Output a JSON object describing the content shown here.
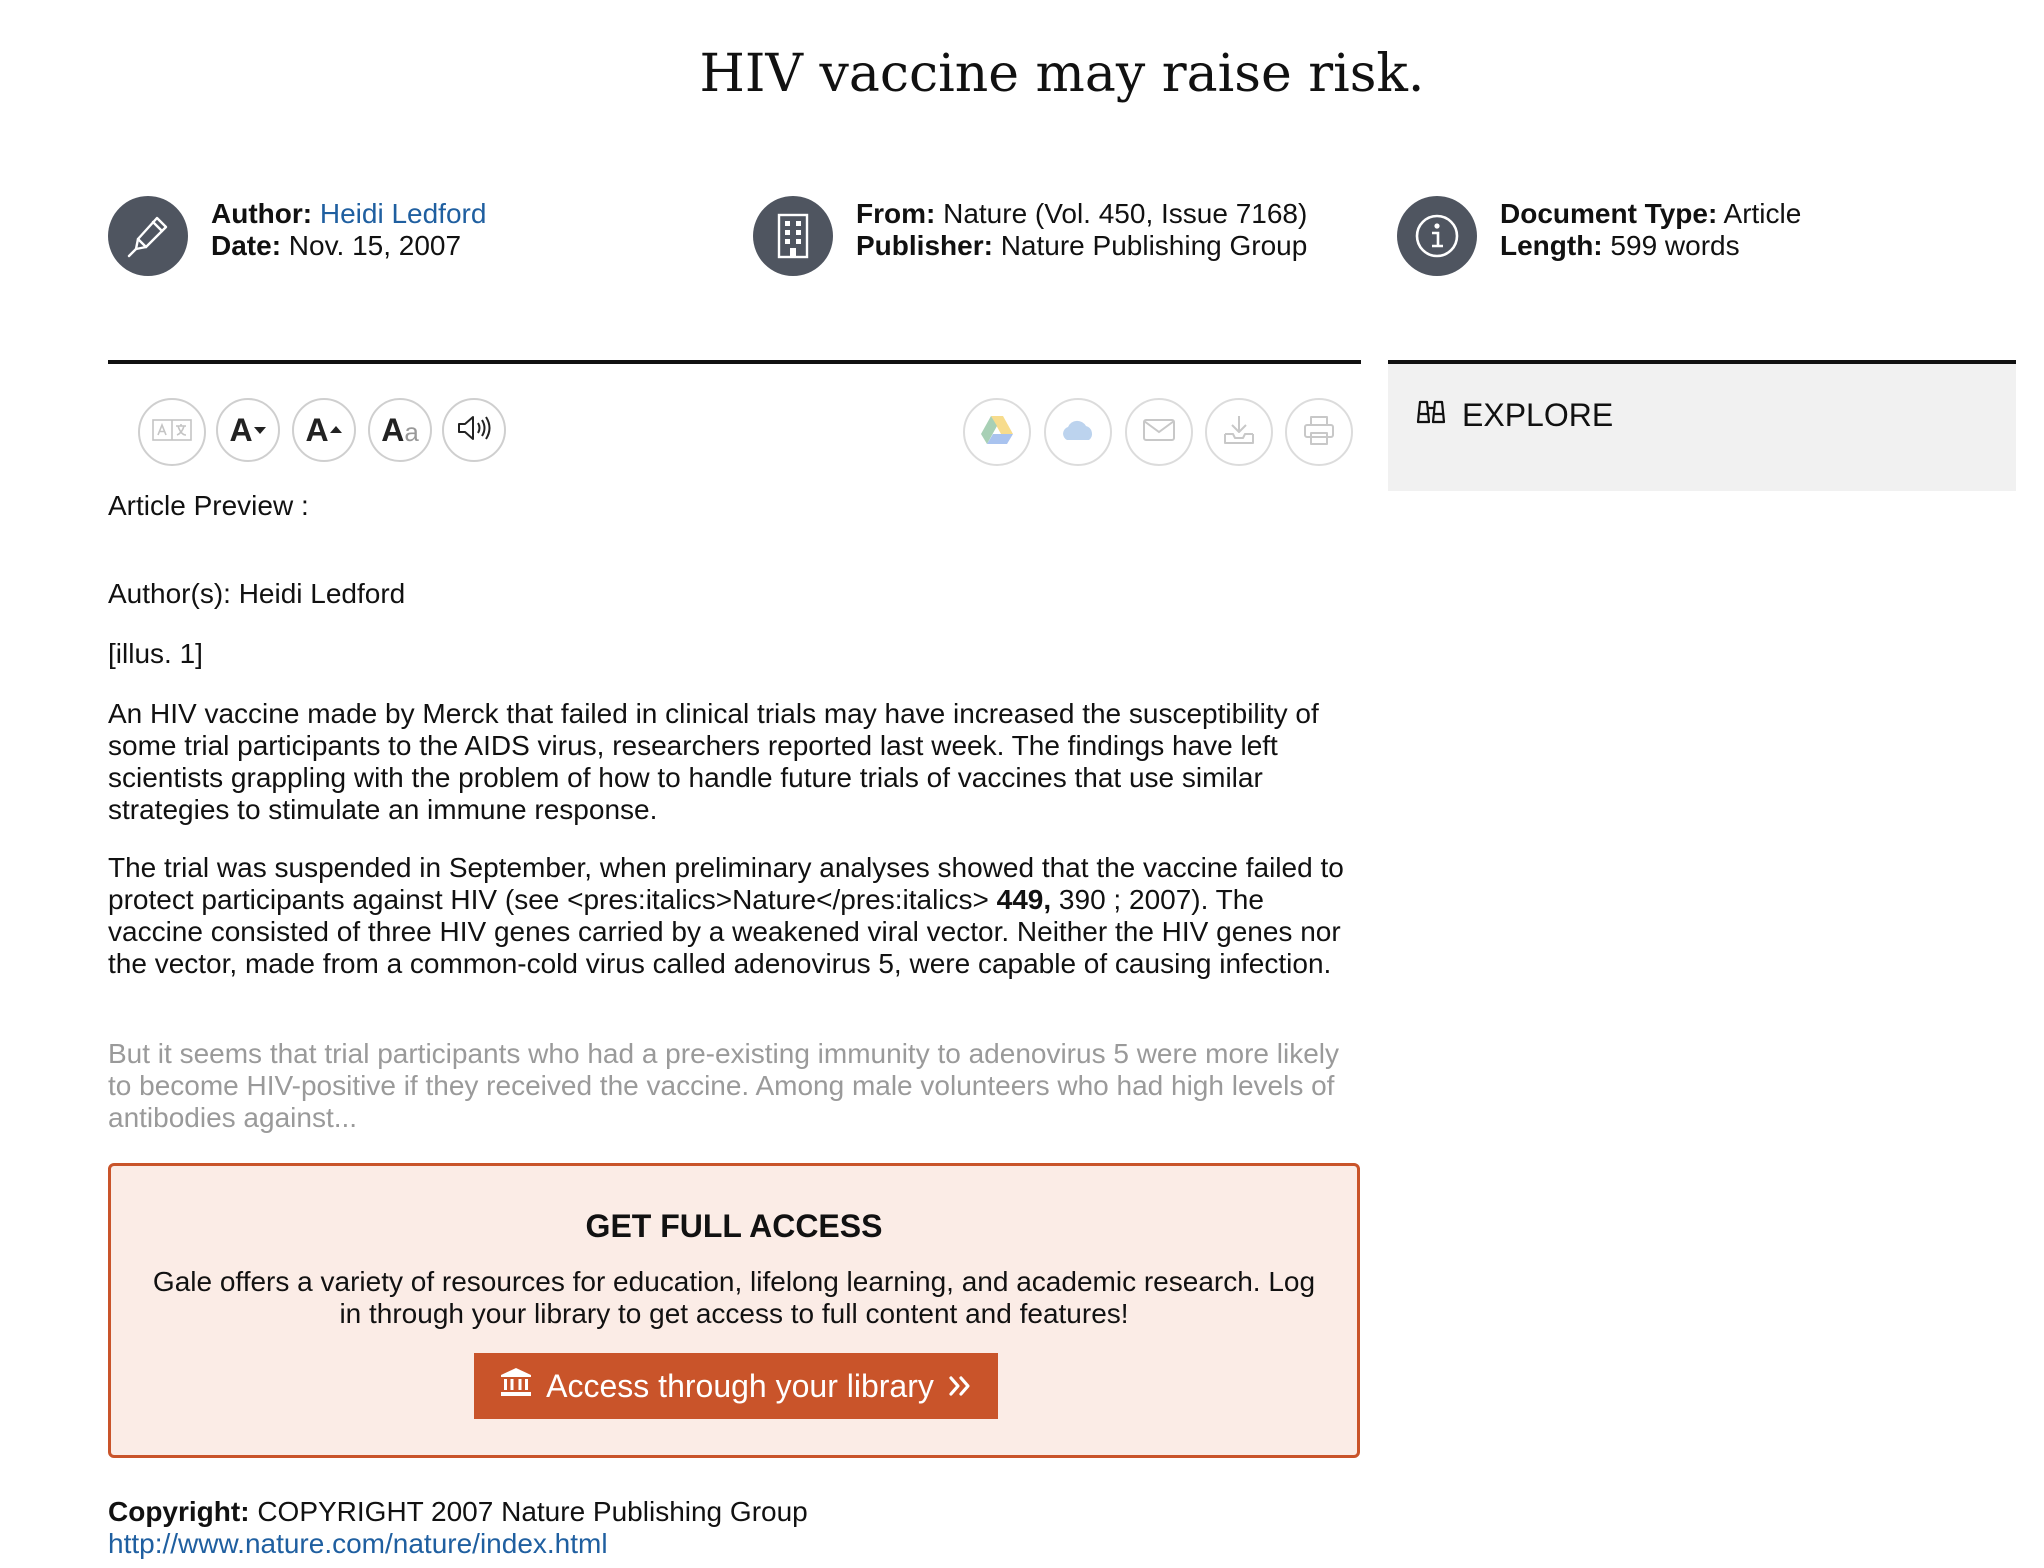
{
  "article": {
    "title": "HIV vaccine may raise risk.",
    "author_label": "Author:",
    "author": "Heidi Ledford",
    "date_label": "Date:",
    "date": "Nov. 15, 2007",
    "from_label": "From:",
    "from": "Nature (Vol. 450, Issue 7168)",
    "publisher_label": "Publisher:",
    "publisher": "Nature Publishing Group",
    "doctype_label": "Document Type:",
    "doctype": "Article",
    "length_label": "Length:",
    "length": "599 words"
  },
  "icons": {
    "author": "pen-nib-icon",
    "source": "building-icon",
    "info": "info-icon",
    "translate": "translate-icon",
    "decrease_font": "decrease-font-icon",
    "increase_font": "increase-font-icon",
    "font_style": "font-style-icon",
    "listen": "speaker-icon",
    "google_drive": "google-drive-icon",
    "onedrive": "onedrive-icon",
    "email": "email-icon",
    "download": "download-icon",
    "print": "print-icon",
    "explore": "binoculars-icon",
    "library": "institution-icon",
    "chevrons": "double-chevron-right-icon"
  },
  "toolbar": {
    "decrease_label": "A",
    "increase_label": "A",
    "font_style_big": "A",
    "font_style_small": "a"
  },
  "sidebar": {
    "explore_label": "EXPLORE"
  },
  "preview": {
    "heading": "Article Preview :",
    "authors": "Author(s): Heidi Ledford",
    "illus": "[illus. 1]",
    "p1": "An HIV vaccine made by Merck that failed in clinical trials may have increased the susceptibility of some trial participants to the AIDS virus, researchers reported last week. The findings have left scientists grappling with the problem of how to handle future trials of vaccines that use similar strategies to stimulate an immune response.",
    "p2_a": "The trial was suspended in September, when preliminary analyses showed that the vaccine failed to protect participants against HIV (see <pres:italics>Nature</pres:italics> ",
    "p2_bold": "449,",
    "p2_b": "  390 ; 2007). The vaccine consisted of three HIV genes carried by a weakened viral vector. Neither the HIV genes nor the vector, made from a common-cold virus called adenovirus 5, were capable of causing infection.",
    "p3": "But it seems that trial participants who had a pre-existing immunity to adenovirus 5 were more likely to become HIV-positive if they received the vaccine. Among male volunteers who had high levels of antibodies against..."
  },
  "access": {
    "title": "GET FULL ACCESS",
    "description": "Gale offers a variety of resources for education, lifelong learning, and academic research. Log in through your library to get access to full content and features!",
    "button_label": "Access through your library"
  },
  "footer": {
    "copyright_label": "Copyright:",
    "copyright": "COPYRIGHT 2007 Nature Publishing Group",
    "url": "http://www.nature.com/nature/index.html"
  },
  "colors": {
    "link": "#1f5fa0",
    "accent": "#c9542a",
    "access_bg": "#fbece6",
    "icon_bg": "#4f5560"
  }
}
